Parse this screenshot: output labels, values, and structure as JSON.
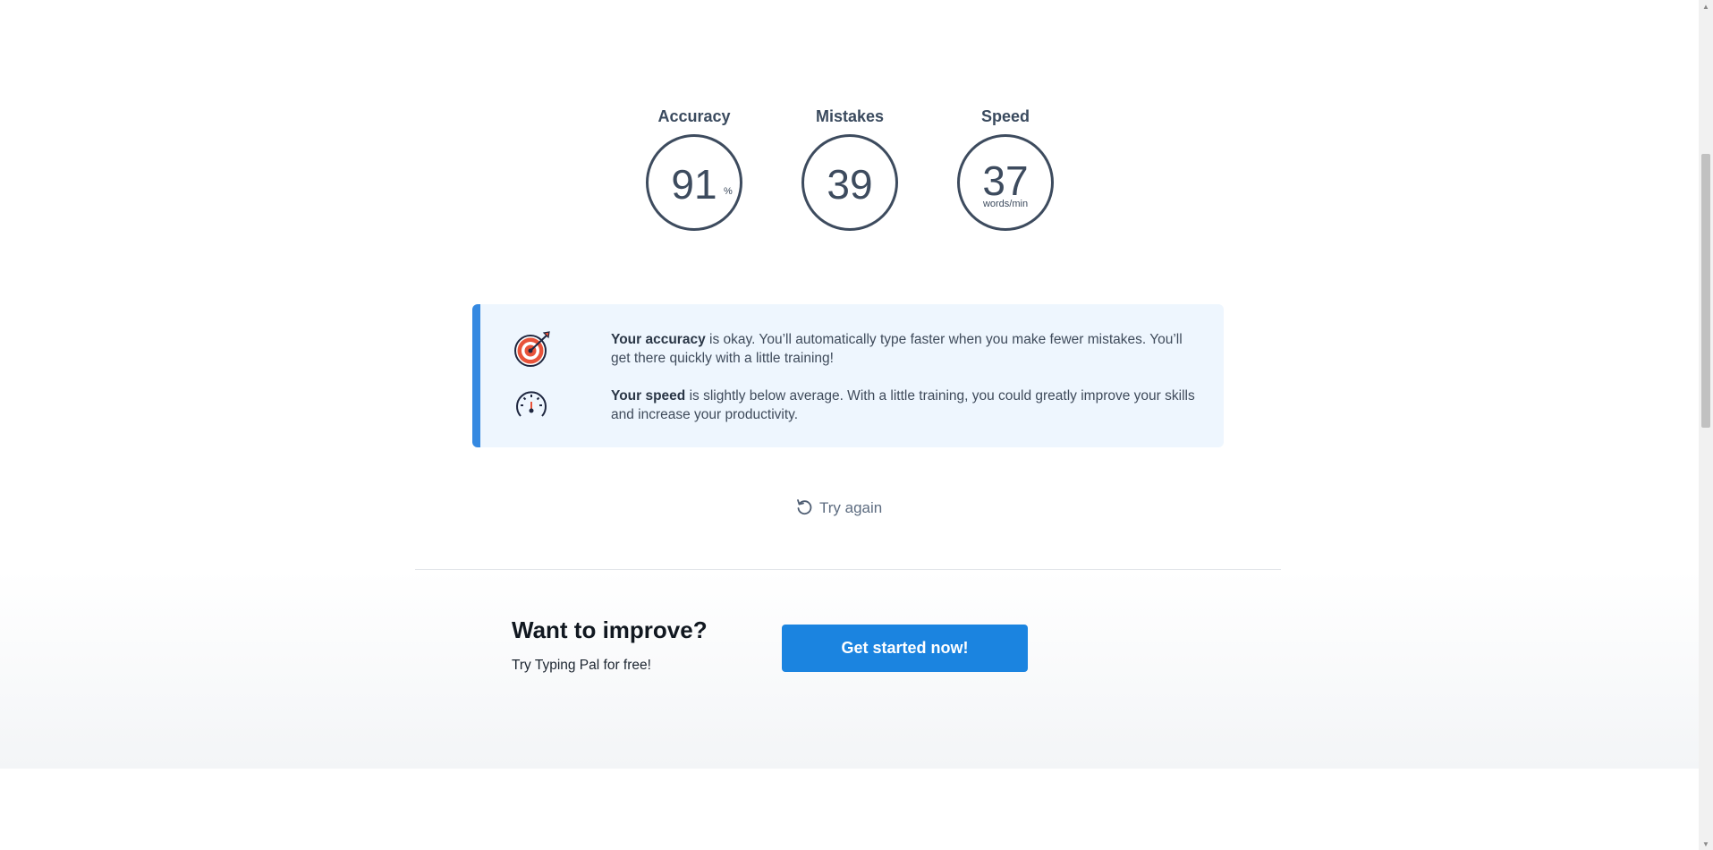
{
  "stats": {
    "accuracy": {
      "label": "Accuracy",
      "value": "91",
      "unit": "%"
    },
    "mistakes": {
      "label": "Mistakes",
      "value": "39"
    },
    "speed": {
      "label": "Speed",
      "value": "37",
      "unit": "words/min"
    }
  },
  "feedback": {
    "accuracy": {
      "icon": "target-icon",
      "bold": "Your accuracy",
      "text": " is okay. You’ll automatically type faster when you make fewer mistakes. You’ll get there quickly with a little training!"
    },
    "speed": {
      "icon": "speedometer-icon",
      "bold": "Your speed",
      "text": " is slightly below average. With a little training, you could greatly improve your skills and increase your productivity."
    }
  },
  "try_again": {
    "label": "Try again",
    "icon": "retry-icon"
  },
  "improve": {
    "title": "Want to improve?",
    "subtitle": "Try Typing Pal for free!",
    "cta_label": "Get started now!"
  },
  "colors": {
    "accent": "#1b84e0",
    "feedback_bg": "#eef6fe",
    "feedback_bar": "#3589e1",
    "ring": "#3d4b5e"
  }
}
